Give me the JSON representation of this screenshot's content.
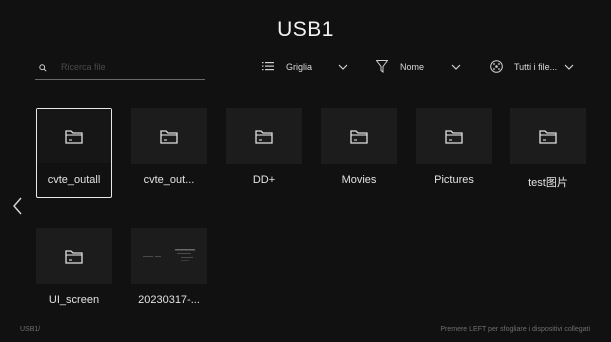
{
  "header": {
    "title": "USB1"
  },
  "search": {
    "placeholder": "Ricerca file"
  },
  "controls": {
    "view_label": "Griglia",
    "sort_label": "Nome",
    "filter_label": "Tutti i file..."
  },
  "files": [
    {
      "name": "cvte_outall",
      "type": "folder",
      "selected": true
    },
    {
      "name": "cvte_out...",
      "type": "folder"
    },
    {
      "name": "DD+",
      "type": "folder"
    },
    {
      "name": "Movies",
      "type": "folder"
    },
    {
      "name": "Pictures",
      "type": "folder"
    },
    {
      "name": "test图片",
      "type": "folder"
    },
    {
      "name": "UI_screen",
      "type": "folder"
    },
    {
      "name": "20230317-...",
      "type": "image"
    }
  ],
  "footer": {
    "path": "USB1/",
    "hint": "Premere LEFT per sfogliare i dispositivi collegati"
  },
  "icons": {
    "search": "search-icon",
    "view": "list-icon",
    "sort": "filter-icon",
    "filter": "file-types-icon",
    "folder": "folder-icon",
    "nav_left": "chevron-left-icon"
  },
  "colors": {
    "background": "#111111",
    "tile": "#1c1c1c",
    "selection": "#e8e8e8"
  }
}
